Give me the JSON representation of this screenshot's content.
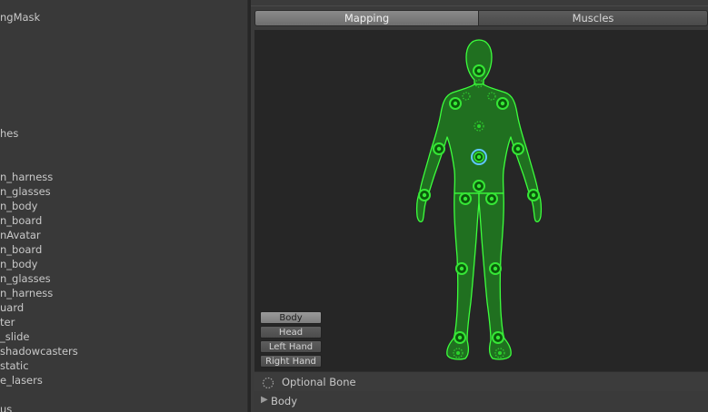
{
  "hierarchy": {
    "items": [
      {
        "label": "ngMask"
      },
      {
        "label": "hes"
      },
      {
        "label": "n_harness"
      },
      {
        "label": "n_glasses"
      },
      {
        "label": "n_body"
      },
      {
        "label": "n_board"
      },
      {
        "label": "nAvatar"
      },
      {
        "label": "n_board"
      },
      {
        "label": "n_body"
      },
      {
        "label": "n_glasses"
      },
      {
        "label": "n_harness"
      },
      {
        "label": "uard"
      },
      {
        "label": "ter"
      },
      {
        "label": "_slide"
      },
      {
        "label": "shadowcasters"
      },
      {
        "label": "static"
      },
      {
        "label": "e_lasers"
      },
      {
        "label": "us"
      }
    ]
  },
  "inspector": {
    "tabs": [
      {
        "label": "Mapping",
        "active": true
      },
      {
        "label": "Muscles",
        "active": false
      }
    ],
    "avatar": {
      "body_color": "#1f8a1f",
      "outline_color": "#3cff3c",
      "selected_bone_color": "#5ec8ff"
    },
    "body_part_buttons": [
      {
        "label": "Body",
        "active": true
      },
      {
        "label": "Head",
        "active": false
      },
      {
        "label": "Left Hand",
        "active": false
      },
      {
        "label": "Right Hand",
        "active": false
      }
    ],
    "legend": {
      "icon": "optional-bone-icon",
      "label": "Optional Bone"
    },
    "foldout": {
      "icon": "triangle-right-icon",
      "label": "Body",
      "expanded": false
    }
  }
}
